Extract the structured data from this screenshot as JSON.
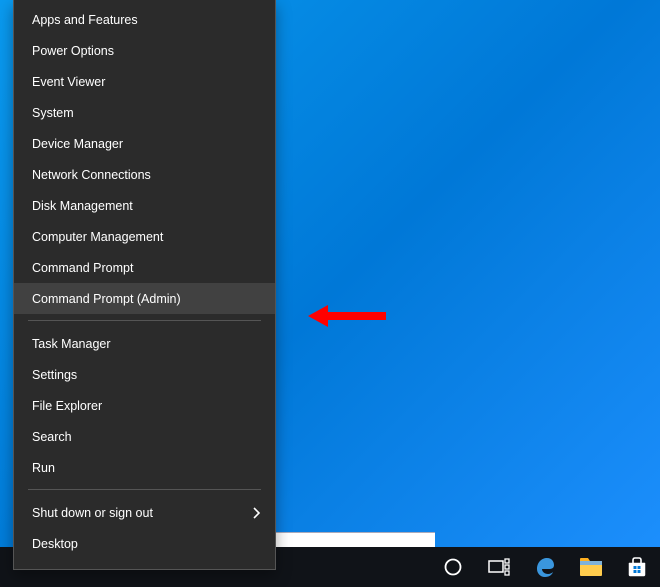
{
  "menu": {
    "group1": [
      {
        "label": "Apps and Features",
        "name": "menu-apps-and-features"
      },
      {
        "label": "Power Options",
        "name": "menu-power-options"
      },
      {
        "label": "Event Viewer",
        "name": "menu-event-viewer"
      },
      {
        "label": "System",
        "name": "menu-system"
      },
      {
        "label": "Device Manager",
        "name": "menu-device-manager"
      },
      {
        "label": "Network Connections",
        "name": "menu-network-connections"
      },
      {
        "label": "Disk Management",
        "name": "menu-disk-management"
      },
      {
        "label": "Computer Management",
        "name": "menu-computer-management"
      },
      {
        "label": "Command Prompt",
        "name": "menu-command-prompt"
      },
      {
        "label": "Command Prompt (Admin)",
        "name": "menu-command-prompt-admin",
        "hovered": true
      }
    ],
    "group2": [
      {
        "label": "Task Manager",
        "name": "menu-task-manager"
      },
      {
        "label": "Settings",
        "name": "menu-settings"
      },
      {
        "label": "File Explorer",
        "name": "menu-file-explorer"
      },
      {
        "label": "Search",
        "name": "menu-search"
      },
      {
        "label": "Run",
        "name": "menu-run"
      }
    ],
    "group3": [
      {
        "label": "Shut down or sign out",
        "name": "menu-shutdown-signout",
        "submenu": true
      },
      {
        "label": "Desktop",
        "name": "menu-desktop"
      }
    ]
  },
  "taskbar": {
    "items": [
      {
        "name": "cortana-icon",
        "kind": "cortana"
      },
      {
        "name": "task-view-icon",
        "kind": "taskview"
      },
      {
        "name": "edge-icon",
        "kind": "edge"
      },
      {
        "name": "file-explorer-icon",
        "kind": "explorer"
      },
      {
        "name": "store-icon",
        "kind": "store"
      }
    ]
  }
}
